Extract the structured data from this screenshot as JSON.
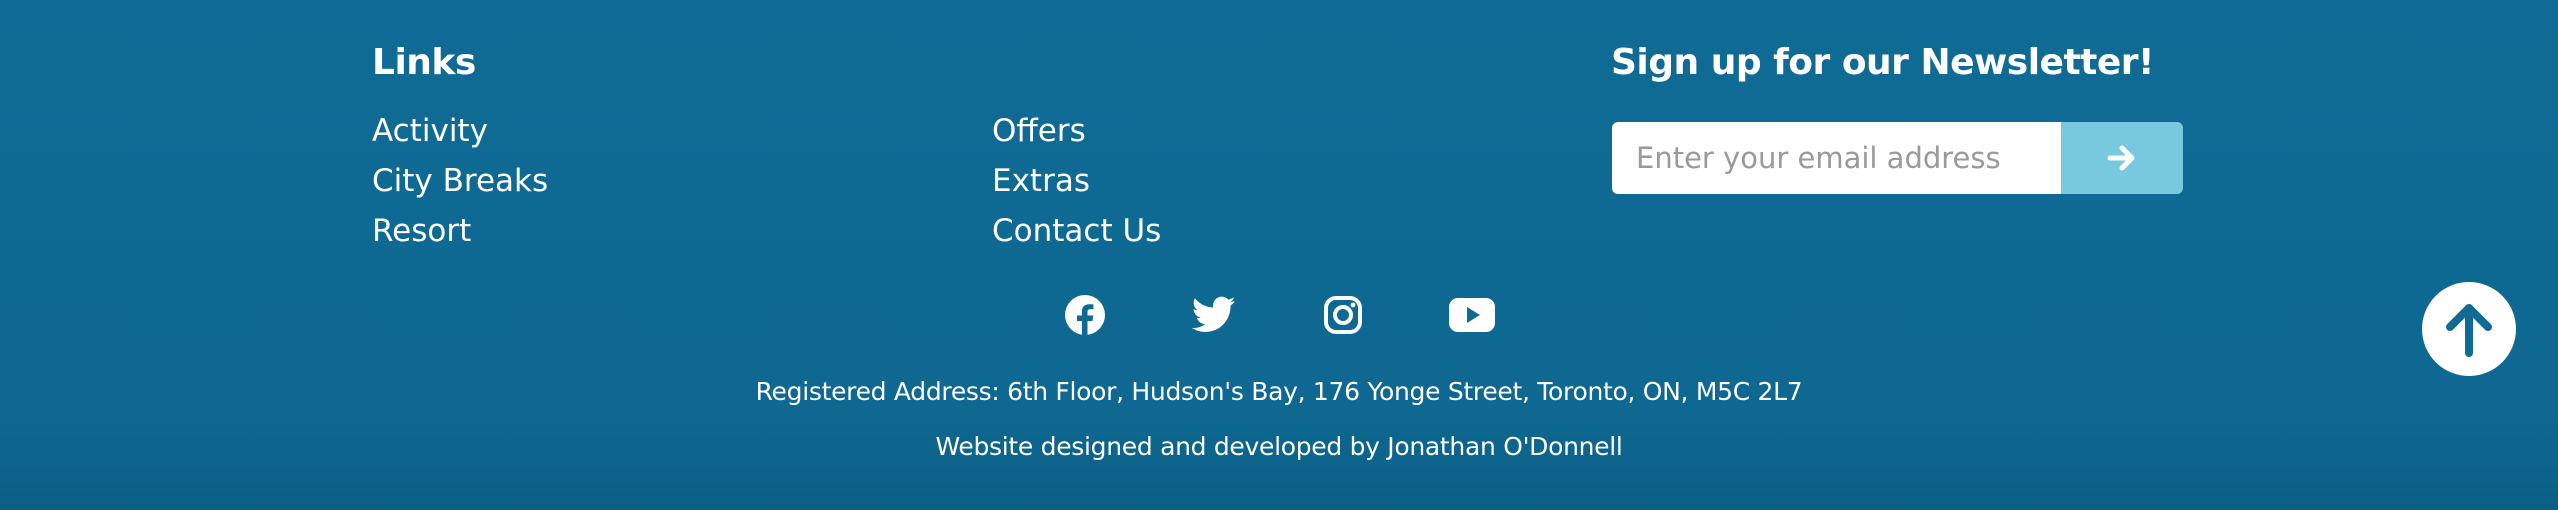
{
  "links": {
    "heading": "Links",
    "column1": [
      "Activity",
      "City Breaks",
      "Resort"
    ],
    "column2": [
      "Offers",
      "Extras",
      "Contact Us"
    ]
  },
  "newsletter": {
    "heading": "Sign up for our Newsletter!",
    "email_placeholder": "Enter your email address",
    "submit_icon": "arrow-right-icon"
  },
  "social": [
    {
      "name": "facebook-icon"
    },
    {
      "name": "twitter-icon"
    },
    {
      "name": "instagram-icon"
    },
    {
      "name": "youtube-icon"
    }
  ],
  "footer": {
    "address": "Registered Address: 6th Floor, Hudson's Bay, 176 Yonge Street, Toronto, ON, M5C 2L7",
    "credit": "Website designed and developed by Jonathan O'Donnell"
  },
  "back_to_top_icon": "arrow-up-icon",
  "colors": {
    "background": "#0f6a94",
    "accent": "#78c8df",
    "text": "#ffffff"
  }
}
